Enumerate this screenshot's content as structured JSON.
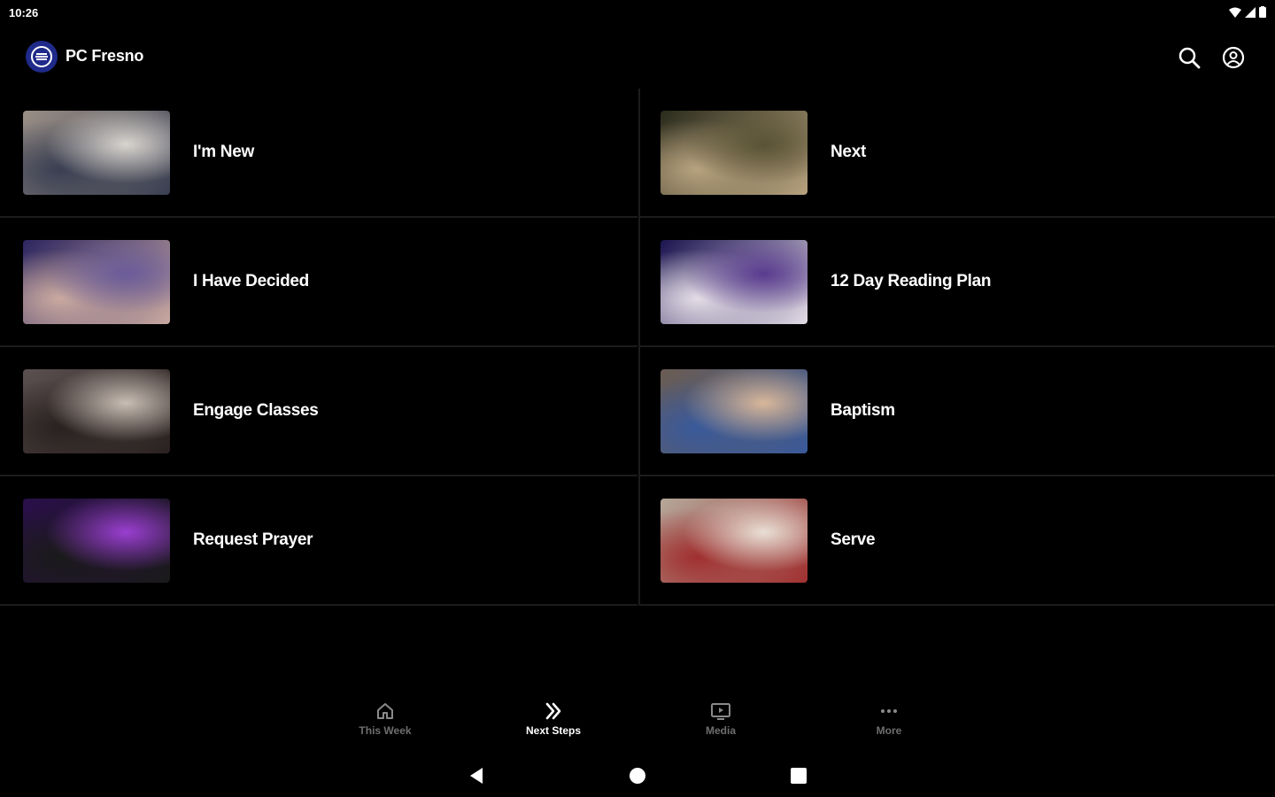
{
  "status": {
    "time": "10:26"
  },
  "app": {
    "title": "PC Fresno"
  },
  "cards": [
    {
      "label": "I'm New",
      "thumb_colors": [
        "#9a8f86",
        "#d8d4cf",
        "#3a3f52"
      ]
    },
    {
      "label": "Next",
      "thumb_colors": [
        "#2a2b1c",
        "#5a5335",
        "#b7a27e"
      ]
    },
    {
      "label": "I Have Decided",
      "thumb_colors": [
        "#2c2560",
        "#6a5b9a",
        "#c9a9a0"
      ]
    },
    {
      "label": "12 Day Reading Plan",
      "thumb_colors": [
        "#1b1450",
        "#5a3b8f",
        "#e3dce6"
      ]
    },
    {
      "label": "Engage Classes",
      "thumb_colors": [
        "#5b5050",
        "#c7bdb3",
        "#2a2220"
      ]
    },
    {
      "label": "Baptism",
      "thumb_colors": [
        "#6b5c52",
        "#d8b79a",
        "#3a5a9a"
      ]
    },
    {
      "label": "Request Prayer",
      "thumb_colors": [
        "#2a0f4a",
        "#9a3fd0",
        "#1a1a1a"
      ]
    },
    {
      "label": "Serve",
      "thumb_colors": [
        "#b4a89a",
        "#e9dfd5",
        "#a03030"
      ]
    }
  ],
  "bottom_nav": [
    {
      "label": "This Week",
      "icon": "home-icon",
      "active": false
    },
    {
      "label": "Next Steps",
      "icon": "double-chevron-icon",
      "active": true
    },
    {
      "label": "Media",
      "icon": "tv-play-icon",
      "active": false
    },
    {
      "label": "More",
      "icon": "more-dots-icon",
      "active": false
    }
  ]
}
